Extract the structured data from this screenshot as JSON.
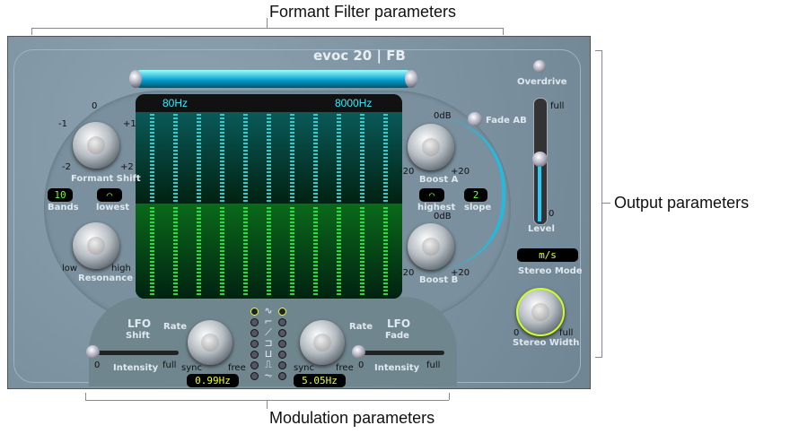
{
  "callouts": {
    "top": "Formant Filter parameters",
    "right": "Output parameters",
    "bottom": "Modulation parameters"
  },
  "plugin": {
    "title": "evoc 20",
    "subtitle": "FB"
  },
  "display": {
    "low_freq": "80Hz",
    "high_freq": "8000Hz"
  },
  "formant_shift": {
    "label": "Formant Shift",
    "ticks": [
      "-1",
      "0",
      "+1",
      "-2",
      "+2"
    ]
  },
  "bands": {
    "value": "10",
    "label": "Bands"
  },
  "lowest": {
    "label": "lowest"
  },
  "resonance": {
    "label": "Resonance",
    "min": "low",
    "max": "high"
  },
  "boost_a": {
    "label": "Boost A",
    "top": "0dB",
    "min": "-20",
    "max": "+20"
  },
  "boost_b": {
    "label": "Boost B",
    "top": "0dB",
    "min": "-20",
    "max": "+20"
  },
  "highest": {
    "label": "highest"
  },
  "slope": {
    "value": "2",
    "label": "slope"
  },
  "fade_ab": {
    "label": "Fade AB"
  },
  "overdrive": {
    "label": "Overdrive"
  },
  "level": {
    "label": "Level",
    "max": "full",
    "min": "0",
    "value": 0.55
  },
  "stereo_mode": {
    "value": "m/s",
    "label": "Stereo Mode"
  },
  "stereo_width": {
    "label": "Stereo Width",
    "min": "0",
    "max": "full"
  },
  "lfo_shift": {
    "title": "LFO",
    "sub": "Shift",
    "rate_label": "Rate",
    "sync": "sync",
    "free": "free",
    "rate": "0.99Hz",
    "intensity": "Intensity",
    "int_min": "0",
    "int_max": "full"
  },
  "lfo_fade": {
    "title": "LFO",
    "sub": "Fade",
    "rate_label": "Rate",
    "sync": "sync",
    "free": "free",
    "rate": "5.05Hz",
    "intensity": "Intensity",
    "int_min": "0",
    "int_max": "full"
  },
  "waveforms": [
    "∿",
    "⌐",
    "⟋",
    "⊐",
    "⊔",
    "⎍",
    "⏦"
  ]
}
